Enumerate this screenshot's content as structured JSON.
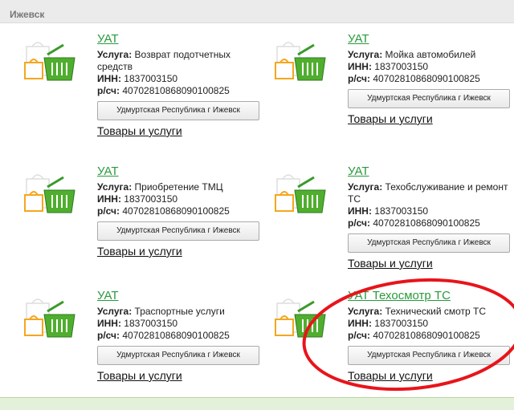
{
  "city": "Ижевск",
  "service_prefix": "Услуга:",
  "inn_prefix": "ИНН:",
  "account_prefix": "р/сч:",
  "cards": [
    {
      "title": "УАТ",
      "service": "Возврат подотчетных средств",
      "inn": "1837003150",
      "account": "40702810868090100825",
      "region": "Удмуртская Республика г Ижевск",
      "goods": "Товары и услуги"
    },
    {
      "title": "УАТ",
      "service": "Мойка автомобилей",
      "inn": "1837003150",
      "account": "40702810868090100825",
      "region": "Удмуртская Республика г Ижевск",
      "goods": "Товары и услуги"
    },
    {
      "title": "УАТ",
      "service": "Приобретение ТМЦ",
      "inn": "1837003150",
      "account": "40702810868090100825",
      "region": "Удмуртская Республика г Ижевск",
      "goods": "Товары и услуги"
    },
    {
      "title": "УАТ",
      "service": "Техобслуживание и ремонт ТС",
      "inn": "1837003150",
      "account": "40702810868090100825",
      "region": "Удмуртская Республика г Ижевск",
      "goods": "Товары и услуги"
    },
    {
      "title": "УАТ",
      "service": "Траспортные услуги",
      "inn": "1837003150",
      "account": "40702810868090100825",
      "region": "Удмуртская Республика г Ижевск",
      "goods": "Товары и услуги"
    },
    {
      "title": "УАТ Техосмотр ТС",
      "service": "Технический смотр ТС",
      "inn": "1837003150",
      "account": "40702810868090100825",
      "region": "Удмуртская Республика г Ижевск",
      "goods": "Товары и услуги"
    }
  ],
  "colors": {
    "link_green": "#2a9a3c",
    "annotation_red": "#e8141b",
    "header_bg": "#ebebeb",
    "band_bg": "#e4f1da"
  },
  "icon": "shopping-bag-and-basket-icon"
}
